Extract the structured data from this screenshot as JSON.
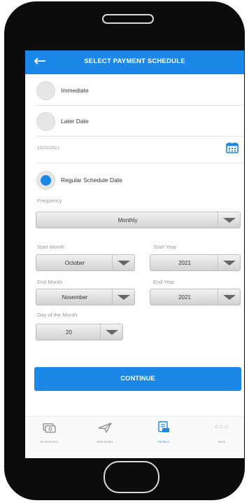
{
  "header": {
    "title": "SELECT PAYMENT SCHEDULE",
    "back_icon": "arrow-left-icon"
  },
  "options": {
    "immediate": {
      "label": "Immediate",
      "selected": false
    },
    "later_date": {
      "label": "Later Date",
      "selected": false,
      "date_value": "10/20/2021"
    },
    "regular_schedule": {
      "label": "Regular Schedule Date",
      "selected": true
    }
  },
  "frequency": {
    "label": "Frequency",
    "value": "Monthly"
  },
  "start_month": {
    "label": "Start Month",
    "value": "October"
  },
  "start_year": {
    "label": "Start Year",
    "value": "2021"
  },
  "end_month": {
    "label": "End Month",
    "value": "November"
  },
  "end_year": {
    "label": "End Year",
    "value": "2021"
  },
  "day_of_month": {
    "label": "Day of the Month",
    "value": "20"
  },
  "continue_button": {
    "label": "CONTINUE"
  },
  "bottom_nav": {
    "items": [
      {
        "label": "MY ACCOUNTS",
        "icon": "money-icon",
        "active": false
      },
      {
        "label": "SEND MONEY",
        "icon": "paper-plane-icon",
        "active": false
      },
      {
        "label": "PAY BILLS",
        "icon": "bill-icon",
        "active": true
      },
      {
        "label": "MORE",
        "icon": "more-dots-icon",
        "active": false
      }
    ]
  },
  "colors": {
    "accent": "#1b87e6",
    "phone_body": "#0c0c0c"
  }
}
